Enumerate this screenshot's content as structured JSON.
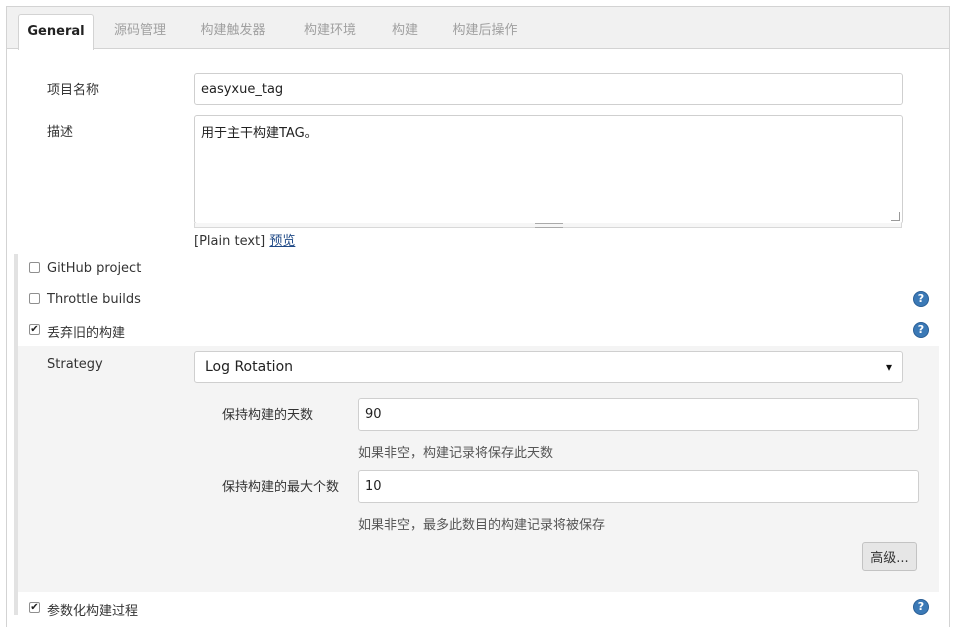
{
  "tabs": [
    {
      "label": "General",
      "active": true
    },
    {
      "label": "源码管理"
    },
    {
      "label": "构建触发器"
    },
    {
      "label": "构建环境"
    },
    {
      "label": "构建"
    },
    {
      "label": "构建后操作"
    }
  ],
  "project_name": {
    "label": "项目名称",
    "value": "easyxue_tag"
  },
  "description": {
    "label": "描述",
    "value": "用于主干构建TAG。",
    "format_note": "[Plain text]",
    "preview_link": "预览"
  },
  "options": {
    "github_project": {
      "label": "GitHub project",
      "checked": false
    },
    "throttle_builds": {
      "label": "Throttle builds",
      "checked": false
    },
    "discard_old_builds": {
      "label": "丢弃旧的构建",
      "checked": true
    },
    "parameterized": {
      "label": "参数化构建过程",
      "checked": true
    }
  },
  "strategy": {
    "label": "Strategy",
    "selected": "Log Rotation",
    "days_to_keep": {
      "label": "保持构建的天数",
      "value": "90",
      "hint": "如果非空，构建记录将保存此天数"
    },
    "max_builds": {
      "label": "保持构建的最大个数",
      "value": "10",
      "hint": "如果非空，最多此数目的构建记录将被保存"
    },
    "advanced_button": "高级..."
  },
  "icons": {
    "help": "?",
    "check": "✔",
    "dropdown": "▾"
  },
  "colors": {
    "help_icon": "#3b79b6",
    "link": "#204a87",
    "section_bg": "#f4f4f4",
    "tabbar_bg": "#f1f1f1"
  }
}
